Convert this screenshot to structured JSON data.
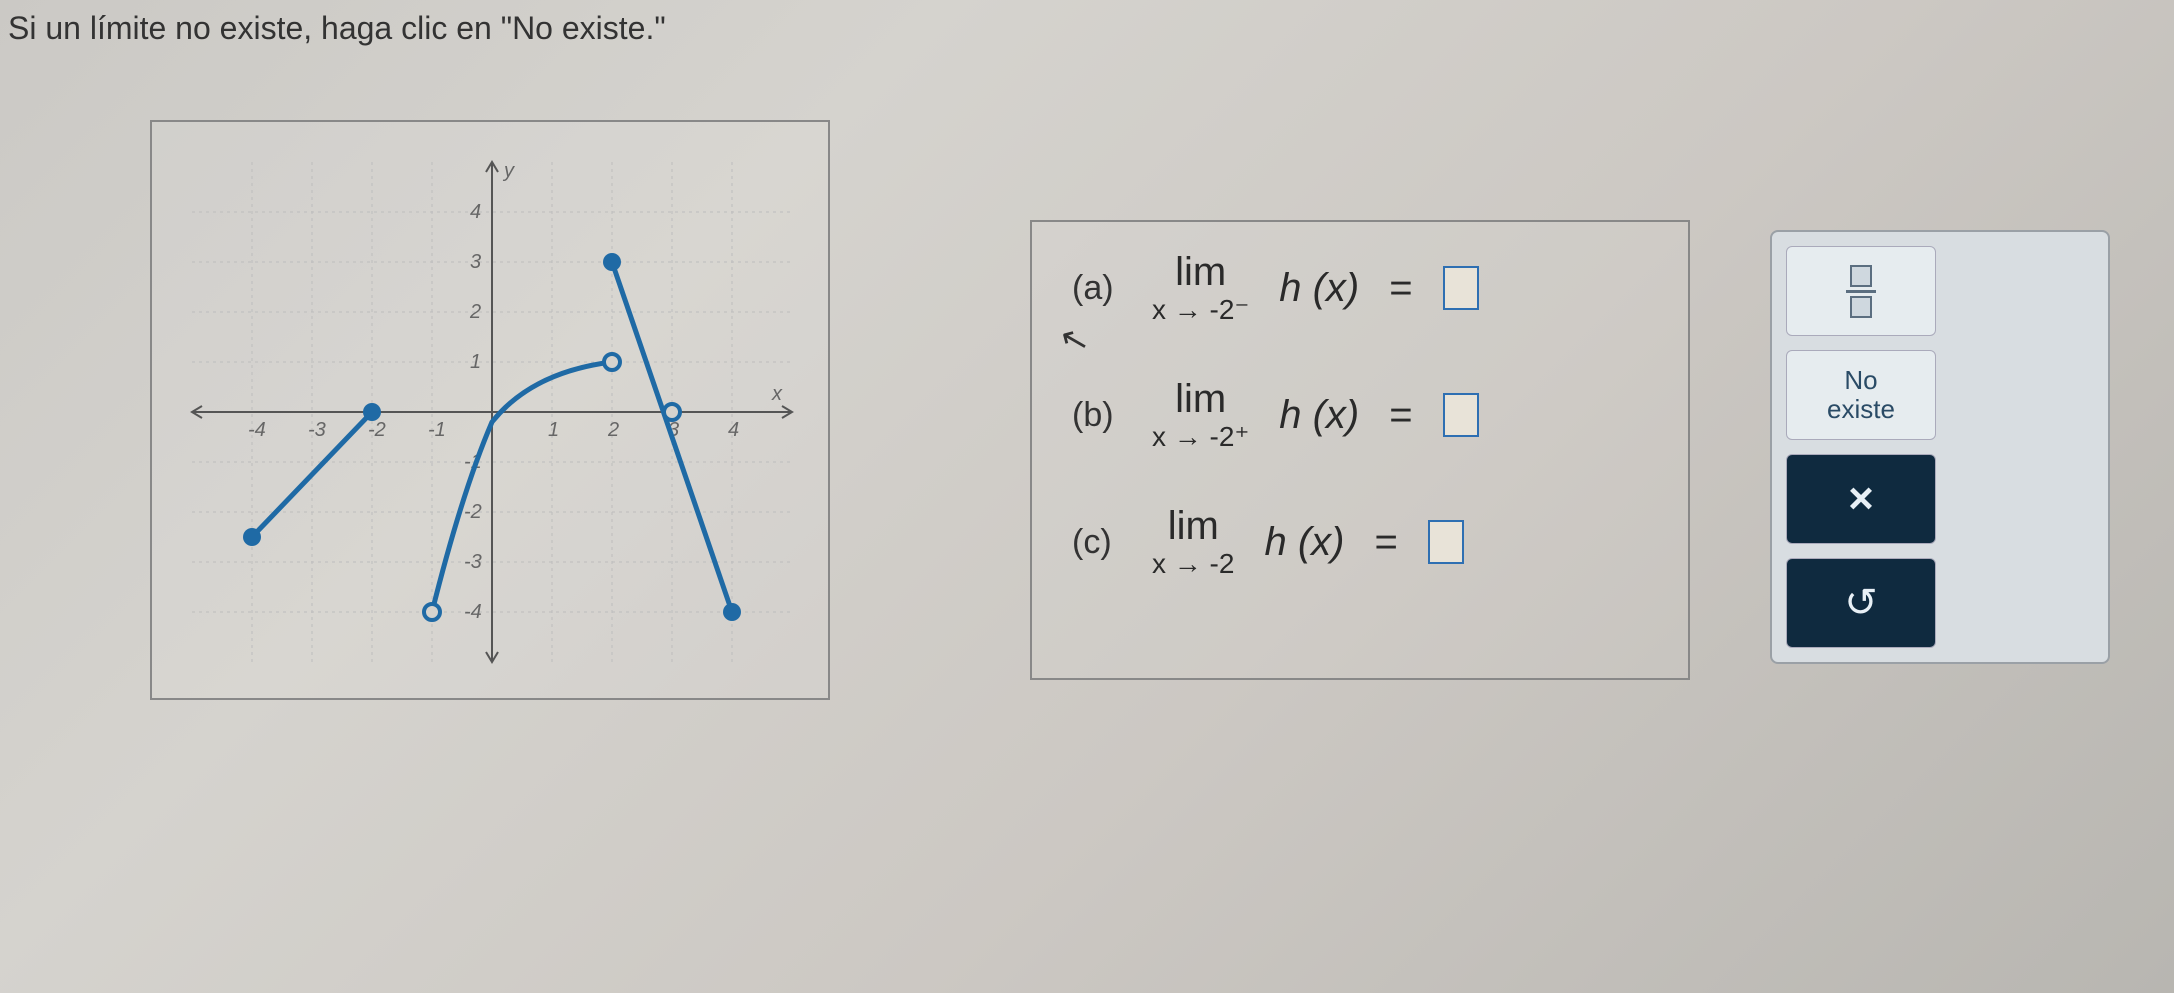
{
  "instruction": "Si un límite no existe, haga clic en \"No existe.\"",
  "chart_data": {
    "type": "line",
    "xlabel": "x",
    "ylabel": "y",
    "xlim": [
      -5,
      5
    ],
    "ylim": [
      -5,
      5
    ],
    "x_ticks": [
      -4,
      -3,
      -2,
      -1,
      1,
      2,
      3,
      4
    ],
    "y_ticks": [
      -4,
      -3,
      -2,
      -1,
      1,
      2,
      3,
      4
    ],
    "series": [
      {
        "name": "segment-left",
        "type": "line",
        "points": [
          [
            -4,
            -2.5
          ],
          [
            -2,
            0
          ]
        ],
        "start_marker": "closed",
        "end_marker": "closed"
      },
      {
        "name": "curve-middle",
        "type": "curve",
        "points": [
          [
            -1,
            -4
          ],
          [
            -0.3,
            -1.2
          ],
          [
            0.4,
            0.2
          ],
          [
            1.2,
            0.8
          ],
          [
            2,
            1
          ]
        ],
        "start_marker": "open",
        "end_marker": "open"
      },
      {
        "name": "segment-right",
        "type": "line",
        "points": [
          [
            2,
            3
          ],
          [
            4,
            -4
          ]
        ],
        "start_marker": "closed",
        "end_marker": "closed"
      },
      {
        "name": "isolated-point",
        "type": "point",
        "points": [
          [
            3,
            0
          ]
        ],
        "start_marker": "open"
      }
    ]
  },
  "answers": {
    "a": {
      "label": "(a)",
      "lim": "lim",
      "approach": "x → -2⁻",
      "func": "h (x)",
      "eq": "="
    },
    "b": {
      "label": "(b)",
      "lim": "lim",
      "approach": "x → -2⁺",
      "func": "h (x)",
      "eq": "="
    },
    "c": {
      "label": "(c)",
      "lim": "lim",
      "approach": "x → -2",
      "func": "h (x)",
      "eq": "="
    }
  },
  "palette": {
    "fraction_label": "□/□",
    "no_exist": "No\nexiste",
    "clear": "×",
    "undo": "↺"
  }
}
